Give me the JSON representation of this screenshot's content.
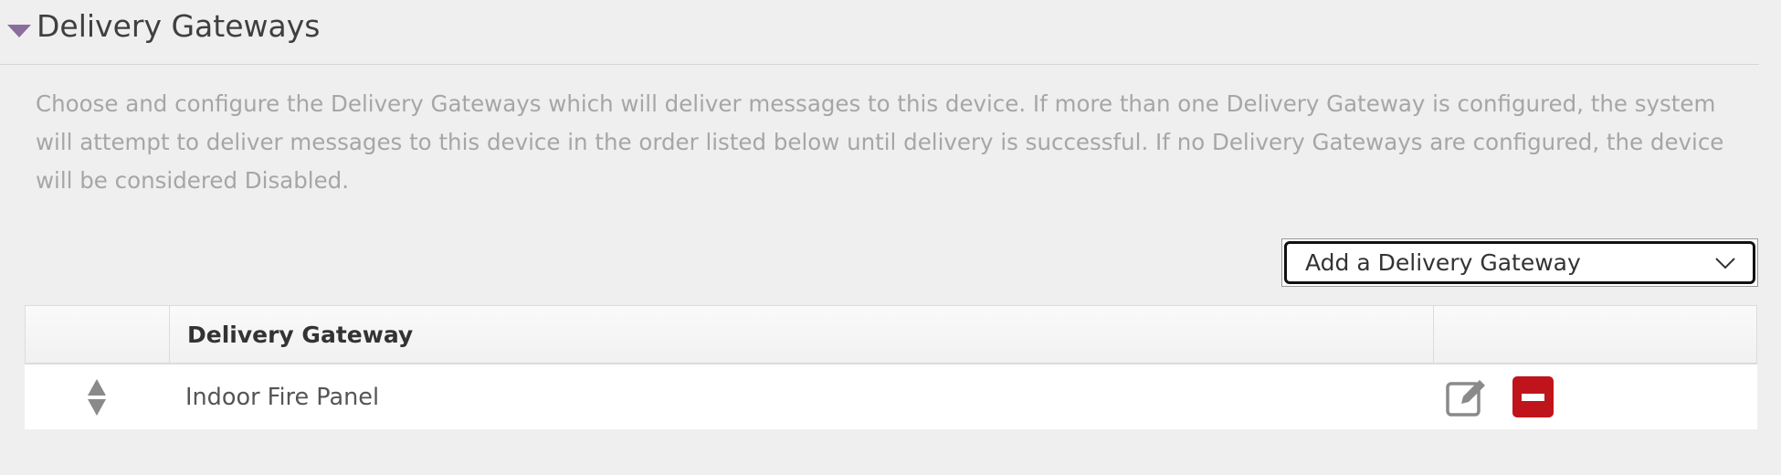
{
  "section": {
    "title": "Delivery Gateways",
    "description": "Choose and configure the Delivery Gateways which will deliver messages to this device. If more than one Delivery Gateway is configured, the system will attempt to deliver messages to this device in the order listed below until delivery is successful. If no Delivery Gateways are configured, the device will be considered Disabled."
  },
  "add_gateway_select": {
    "selected": "Add a Delivery Gateway"
  },
  "table": {
    "columns": [
      "",
      "Delivery Gateway",
      ""
    ],
    "rows": [
      {
        "name": "Indoor Fire Panel"
      }
    ]
  },
  "colors": {
    "toggle": "#8a6d9e",
    "remove_button": "#c0141c",
    "description_text": "#a6a6a6"
  },
  "icons": {
    "toggle": "caret-down-icon",
    "select": "chevron-down-icon",
    "sort": "sort-handle-icon",
    "edit": "edit-icon",
    "remove": "minus-icon"
  }
}
